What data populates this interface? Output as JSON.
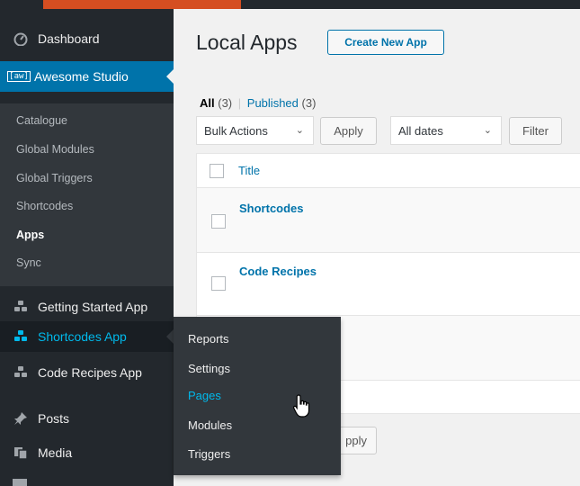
{
  "admin_menu": {
    "dashboard": "Dashboard",
    "awesome_studio": "Awesome Studio",
    "awesome_studio_badge": "[aw]",
    "submenu": [
      "Catalogue",
      "Global Modules",
      "Global Triggers",
      "Shortcodes",
      "Apps",
      "Sync"
    ],
    "current_sub": "Apps",
    "getting_started": "Getting Started App",
    "shortcodes_app": "Shortcodes App",
    "code_recipes_app": "Code Recipes App",
    "posts": "Posts",
    "media": "Media"
  },
  "flyout": {
    "items": [
      "Reports",
      "Settings",
      "Pages",
      "Modules",
      "Triggers"
    ],
    "highlighted": "Pages"
  },
  "page": {
    "title": "Local Apps",
    "create_button": "Create New App",
    "views": {
      "all_label": "All",
      "all_count": "(3)",
      "separator": "|",
      "published_label": "Published",
      "published_count": "(3)"
    },
    "bulk_actions": "Bulk Actions",
    "apply_label": "Apply",
    "apply_bottom_fragment": "pply",
    "all_dates": "All dates",
    "filter_label": "Filter"
  },
  "table": {
    "header_title": "Title",
    "rows": [
      "Shortcodes",
      "Code Recipes"
    ]
  },
  "colors": {
    "sidebar_bg": "#23282d",
    "active_bg": "#0073aa",
    "link": "#0073aa",
    "hover_link": "#00b9eb",
    "top_accent": "#d54e21"
  },
  "icons": [
    "dashboard-icon",
    "studio-badge-icon",
    "app-icon",
    "pin-icon",
    "media-icon",
    "chevron-down-icon",
    "hand-pointer-icon"
  ]
}
